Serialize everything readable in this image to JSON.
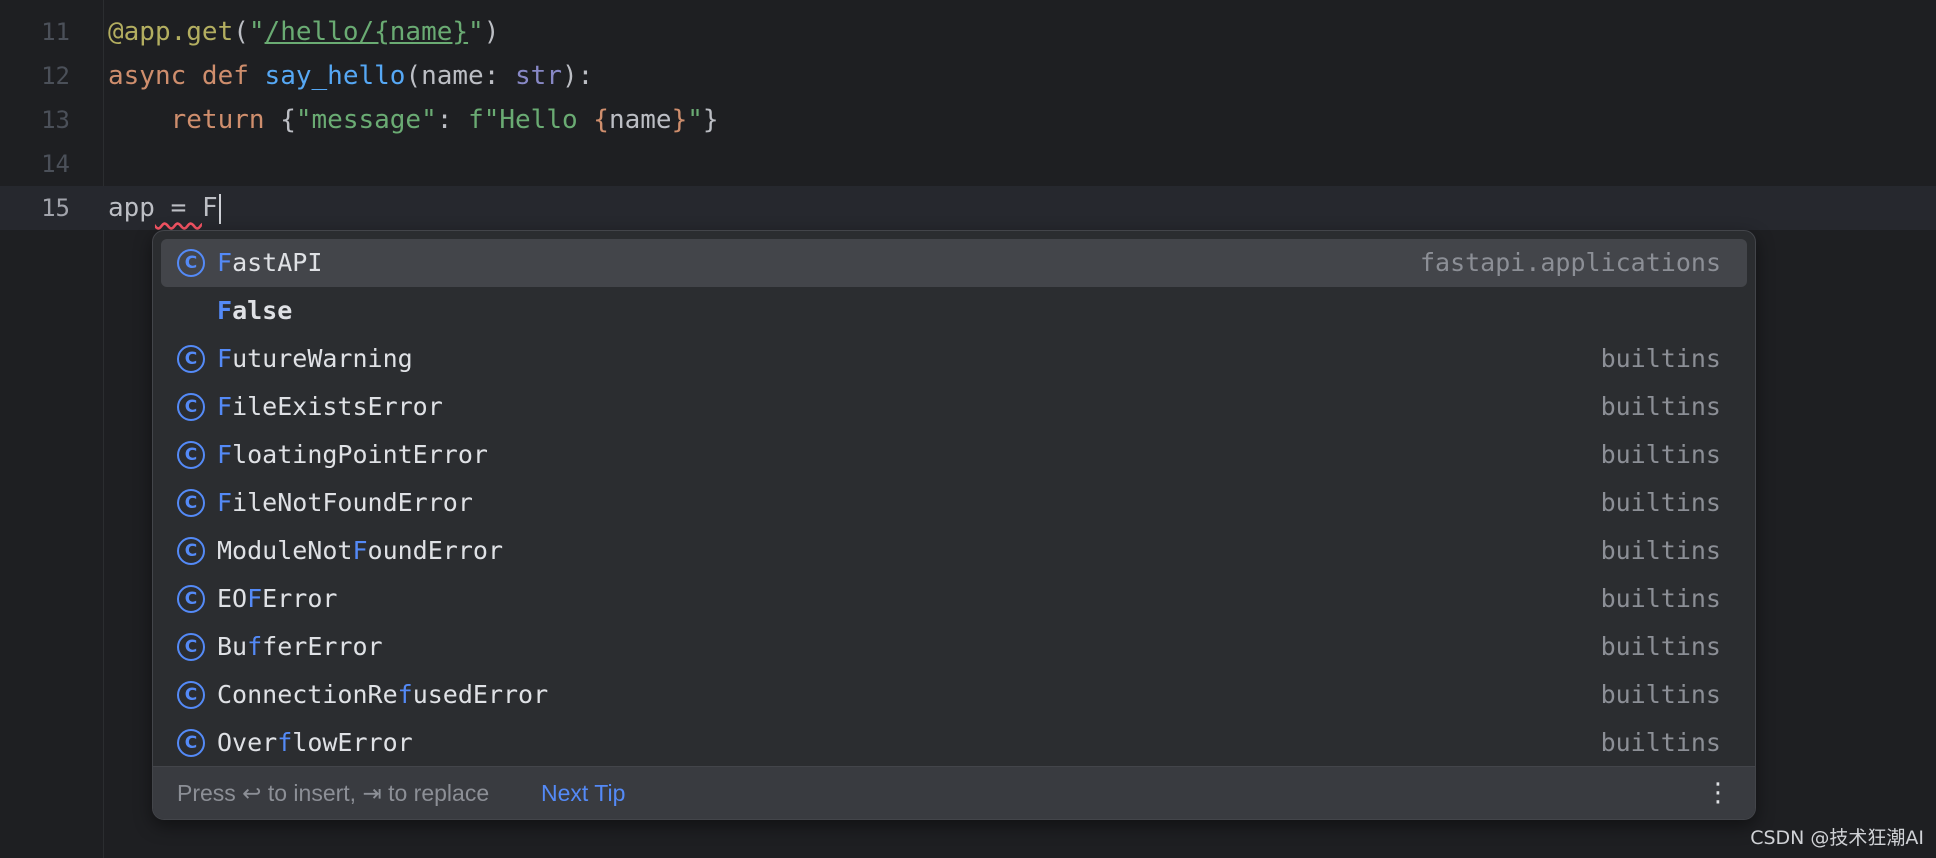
{
  "editor": {
    "lines": [
      {
        "number": "11",
        "parts": [
          {
            "t": "@app.get",
            "c": "deco"
          },
          {
            "t": "(",
            "c": ""
          },
          {
            "t": "\"",
            "c": "str"
          },
          {
            "t": "/hello/{name}",
            "c": "strlink"
          },
          {
            "t": "\"",
            "c": "str"
          },
          {
            "t": ")",
            "c": ""
          }
        ]
      },
      {
        "number": "12",
        "parts": [
          {
            "t": "async def ",
            "c": "kw"
          },
          {
            "t": "say_hello",
            "c": "fn"
          },
          {
            "t": "(name: ",
            "c": ""
          },
          {
            "t": "str",
            "c": "bi"
          },
          {
            "t": "):",
            "c": ""
          }
        ]
      },
      {
        "number": "13",
        "parts": [
          {
            "t": "    ",
            "c": ""
          },
          {
            "t": "return ",
            "c": "kw"
          },
          {
            "t": "{",
            "c": ""
          },
          {
            "t": "\"message\"",
            "c": "str"
          },
          {
            "t": ": ",
            "c": ""
          },
          {
            "t": "f\"Hello ",
            "c": "str"
          },
          {
            "t": "{",
            "c": "brace"
          },
          {
            "t": "name",
            "c": ""
          },
          {
            "t": "}",
            "c": "brace"
          },
          {
            "t": "\"",
            "c": "str"
          },
          {
            "t": "}",
            "c": ""
          }
        ]
      },
      {
        "number": "14",
        "parts": []
      },
      {
        "number": "15",
        "current": true,
        "parts": [
          {
            "t": "app",
            "c": ""
          },
          {
            "t": " = ",
            "c": "err"
          },
          {
            "t": "F",
            "c": ""
          }
        ]
      }
    ]
  },
  "completion": {
    "items": [
      {
        "match": "F",
        "rest": "astAPI",
        "icon": "class-icon",
        "source": "fastapi.applications",
        "selected": true
      },
      {
        "match": "F",
        "rest": "alse",
        "icon": "",
        "source": "",
        "bold": true
      },
      {
        "match": "F",
        "rest": "utureWarning",
        "icon": "class-icon",
        "source": "builtins"
      },
      {
        "match": "F",
        "rest": "ileExistsError",
        "icon": "class-icon",
        "source": "builtins"
      },
      {
        "match": "F",
        "rest": "loatingPointError",
        "icon": "class-icon",
        "source": "builtins"
      },
      {
        "match": "F",
        "rest": "ileNotFoundError",
        "icon": "class-icon",
        "source": "builtins"
      },
      {
        "pre": "ModuleNot",
        "match": "F",
        "rest": "oundError",
        "icon": "class-icon",
        "source": "builtins"
      },
      {
        "pre": "EO",
        "match": "F",
        "rest": "Error",
        "icon": "class-icon",
        "source": "builtins"
      },
      {
        "pre": "Bu",
        "match": "f",
        "rest": "ferError",
        "icon": "class-icon",
        "source": "builtins"
      },
      {
        "pre": "ConnectionRe",
        "match": "f",
        "rest": "usedError",
        "icon": "class-icon",
        "source": "builtins"
      },
      {
        "pre": "Over",
        "match": "f",
        "rest": "lowError",
        "icon": "class-icon",
        "source": "builtins"
      }
    ],
    "icon_glyph": "C",
    "footer": {
      "hint": "Press ↩ to insert, ⇥ to replace",
      "tip": "Next Tip",
      "more": "⋮"
    }
  },
  "watermark": "CSDN @技术狂潮AI",
  "colors": {
    "background": "#1e1f22",
    "accent": "#548af7",
    "popup": "#2b2d30"
  }
}
